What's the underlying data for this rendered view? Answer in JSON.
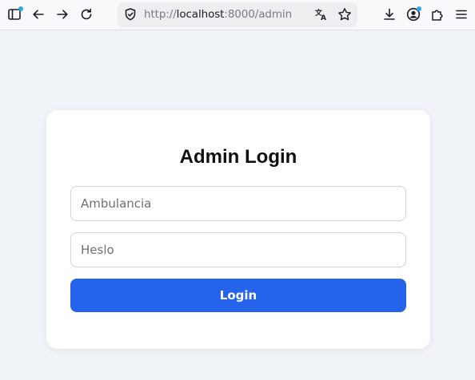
{
  "browser": {
    "url_scheme_prefix": "http://",
    "url_host": "localhost",
    "url_rest": ":8000/admin",
    "icons": [
      "sidebar-icon",
      "back-arrow-icon",
      "forward-arrow-icon",
      "reload-icon",
      "shield-icon",
      "translate-icon",
      "star-icon",
      "download-icon",
      "account-icon",
      "extensions-icon",
      "menu-icon"
    ],
    "accent_dot_color": "#2fa6e0"
  },
  "login": {
    "title": "Admin Login",
    "username_placeholder": "Ambulancia",
    "password_placeholder": "Heslo",
    "submit_label": "Login"
  },
  "colors": {
    "page_background": "#f0f3f8",
    "button": "#2563eb"
  }
}
